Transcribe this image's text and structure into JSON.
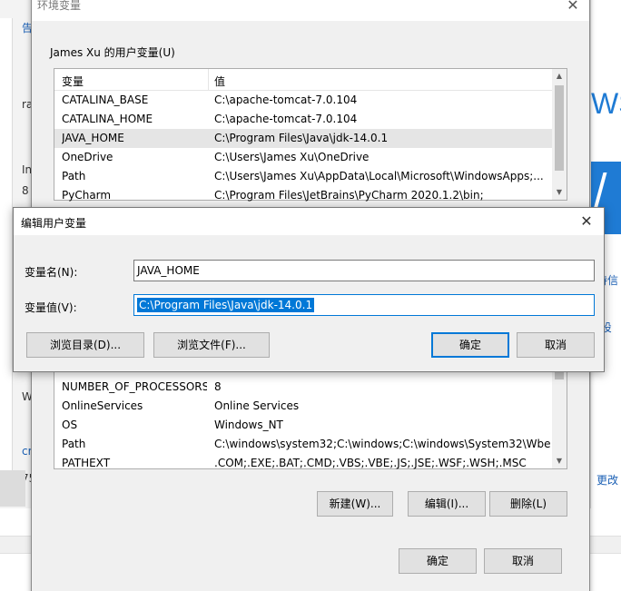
{
  "env_dialog": {
    "title": "环境变量",
    "user_group_label": "James Xu 的用户变量(U)",
    "col_variable": "变量",
    "col_value": "值",
    "user_rows": [
      {
        "name": "CATALINA_BASE",
        "value": "C:\\apache-tomcat-7.0.104"
      },
      {
        "name": "CATALINA_HOME",
        "value": "C:\\apache-tomcat-7.0.104"
      },
      {
        "name": "JAVA_HOME",
        "value": "C:\\Program Files\\Java\\jdk-14.0.1"
      },
      {
        "name": "OneDrive",
        "value": "C:\\Users\\James Xu\\OneDrive"
      },
      {
        "name": "Path",
        "value": "C:\\Users\\James Xu\\AppData\\Local\\Microsoft\\WindowsApps;..."
      },
      {
        "name": "PyCharm",
        "value": "C:\\Program Files\\JetBrains\\PyCharm 2020.1.2\\bin;"
      }
    ],
    "system_rows": [
      {
        "name": "NUMBER_OF_PROCESSORS",
        "value": "8"
      },
      {
        "name": "OnlineServices",
        "value": "Online Services"
      },
      {
        "name": "OS",
        "value": "Windows_NT"
      },
      {
        "name": "Path",
        "value": "C:\\windows\\system32;C:\\windows;C:\\windows\\System32\\Wbe..."
      },
      {
        "name": "PATHEXT",
        "value": ".COM;.EXE;.BAT;.CMD;.VBS;.VBE;.JS;.JSE;.WSF;.WSH;.MSC"
      }
    ],
    "new_button": "新建(W)...",
    "edit_button": "编辑(I)...",
    "delete_button": "删除(L)",
    "ok_button": "确定",
    "cancel_button": "取消"
  },
  "edit_dialog": {
    "title": "编辑用户变量",
    "name_label": "变量名(N):",
    "name_value": "JAVA_HOME",
    "value_label": "变量值(V):",
    "value_value": "C:\\Program Files\\Java\\jdk-14.0.1",
    "browse_dir_button": "浏览目录(D)...",
    "browse_file_button": "浏览文件(F)...",
    "ok_button": "确定",
    "cancel_button": "取消"
  },
  "background": {
    "left_fragments": [
      "告",
      "ra",
      "In",
      "8",
      "W",
      "cr",
      "75"
    ],
    "right_ws": "WS",
    "right_text_1": "待信",
    "right_text_2": "t设",
    "right_text_3": "更改"
  }
}
